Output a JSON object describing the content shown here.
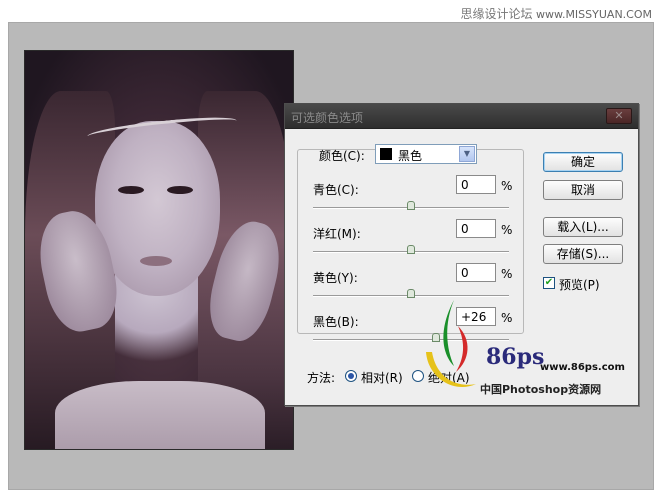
{
  "watermark": {
    "text_cn": "思缘设计论坛",
    "text_url": "www.MISSYUAN.COM"
  },
  "dialog": {
    "title": "可选颜色选项",
    "close_icon": "close-icon",
    "colors_label": "颜色(C):",
    "colors_value": "黑色",
    "sliders": [
      {
        "label": "青色(C):",
        "value": "0",
        "unit": "%",
        "position": 0.5
      },
      {
        "label": "洋红(M):",
        "value": "0",
        "unit": "%",
        "position": 0.5
      },
      {
        "label": "黄色(Y):",
        "value": "0",
        "unit": "%",
        "position": 0.5
      },
      {
        "label": "黑色(B):",
        "value": "+26",
        "unit": "%",
        "position": 0.63
      }
    ],
    "buttons": {
      "ok": "确定",
      "cancel": "取消",
      "load": "载入(L)...",
      "save": "存储(S)..."
    },
    "preview": {
      "label": "预览(P)",
      "checked": true
    },
    "method": {
      "label": "方法:",
      "options": [
        {
          "label": "相对(R)",
          "selected": true
        },
        {
          "label": "绝对(A)",
          "selected": false
        }
      ]
    }
  },
  "logo": {
    "brand": "86ps",
    "url": "www.86ps.com",
    "tagline": "中国Photoshop资源网"
  }
}
